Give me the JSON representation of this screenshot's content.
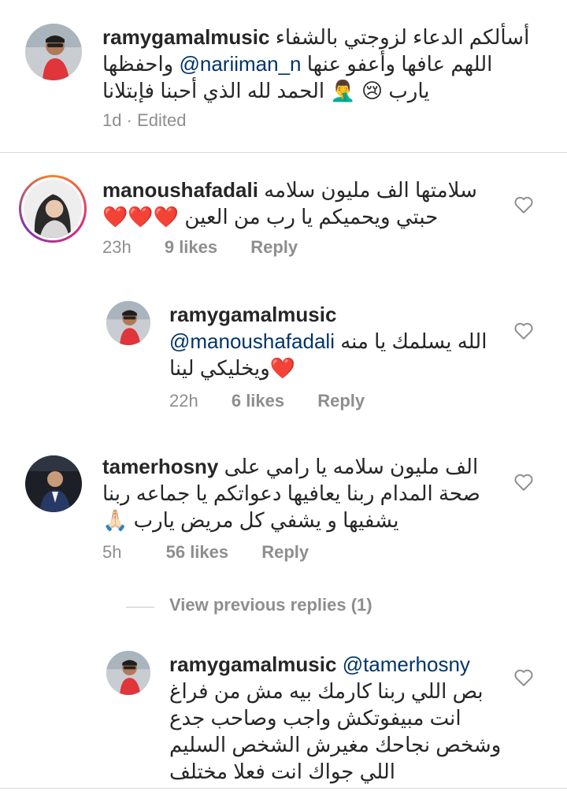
{
  "colors": {
    "text": "#262626",
    "meta": "#8e8e8e",
    "mention": "#003569",
    "heart_red": "#ed4956",
    "divider": "#dbdbdb"
  },
  "caption": {
    "username": "ramygamalmusic",
    "line1": "أسألكم الدعاء  لزوجتي بالشفاء",
    "line2_mention": "@nariiman_n",
    "line2_text": "واحفظها",
    "line2_suffix": "اللهم عافها وأعفو عنها",
    "line3_text": "يارب",
    "line3_suffix": "الحمد لله الذي أحبنا فإبتلانا",
    "emoji_1": "😢",
    "emoji_2": "🤦‍♂️",
    "time": "1d",
    "edited": "· Edited"
  },
  "comments": [
    {
      "username": "manoushafadali",
      "line1": "سلامتها الف مليون سلامه",
      "line2": "حبتي ويحميكم يا رب من العين",
      "hearts": "❤️❤️❤️",
      "time": "23h",
      "likes": "9 likes",
      "reply": "Reply",
      "like_icon": "heart-outline-icon"
    },
    {
      "username": "ramygamalmusic",
      "mention": "@manoushafadali",
      "line1_text": "الله يسلمك يا منه",
      "line2_text": "ويخليكي لينا",
      "heart": "❤️",
      "time": "22h",
      "likes": "6 likes",
      "reply": "Reply",
      "like_icon": "heart-outline-icon"
    },
    {
      "username": "tamerhosny",
      "line1_text": "الف مليون سلامه يا رامي على",
      "line2": "صحة المدام ربنا يعافيها دعواتكم يا جماعه ربنا",
      "line3": "يشفيها و يشفي كل مريض يارب",
      "emoji": "🙏🏻",
      "time": "5h",
      "likes": "56 likes",
      "reply": "Reply",
      "like_icon": "heart-outline-icon"
    },
    {
      "username": "ramygamalmusic",
      "mention": "@tamerhosny",
      "line2": "بص اللي ربنا كارمك بيه مش من فراغ",
      "line3": "انت مبيفوتكش واجب وصاحب جدع",
      "line4": "وشخص نجاحك مغيرش الشخص السليم",
      "line5": "اللي جواك انت فعلا مختلف",
      "like_icon": "heart-outline-icon"
    }
  ],
  "view_previous_replies": "View previous replies (1)"
}
